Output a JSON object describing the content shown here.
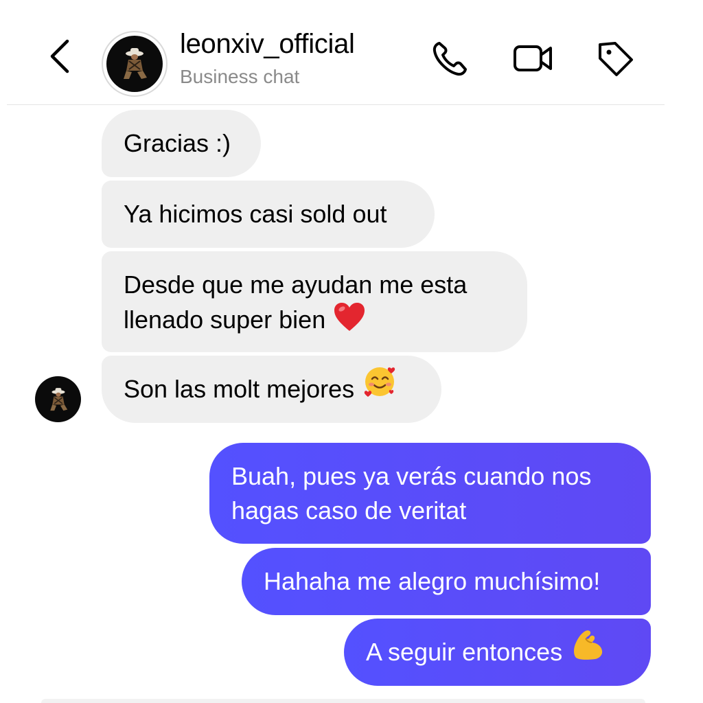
{
  "header": {
    "username": "leonxiv_official",
    "subtitle": "Business chat",
    "icons": [
      "back-chevron-icon",
      "phone-icon",
      "video-camera-icon",
      "tag-icon"
    ]
  },
  "messages": [
    {
      "side": "received",
      "text": "Gracias :)"
    },
    {
      "side": "received",
      "text": "Ya hicimos casi sold out"
    },
    {
      "side": "received",
      "line1": "Desde que me ayudan me esta",
      "line2": "llenado super bien",
      "emoji": "red-heart"
    },
    {
      "side": "received",
      "text": "Son las molt mejores",
      "emoji": "smiling-face-with-hearts"
    },
    {
      "side": "sent",
      "line1": "Buah, pues ya verás cuando nos",
      "line2": "hagas caso de veritat"
    },
    {
      "side": "sent",
      "text": "Hahaha me alegro muchísimo!"
    },
    {
      "side": "sent",
      "text": "A seguir entonces",
      "emoji": "flexed-biceps"
    }
  ],
  "colors": {
    "received_bubble": "#efefef",
    "sent_bubble": "#5451ff",
    "subtitle_text": "#8a8a8a"
  }
}
